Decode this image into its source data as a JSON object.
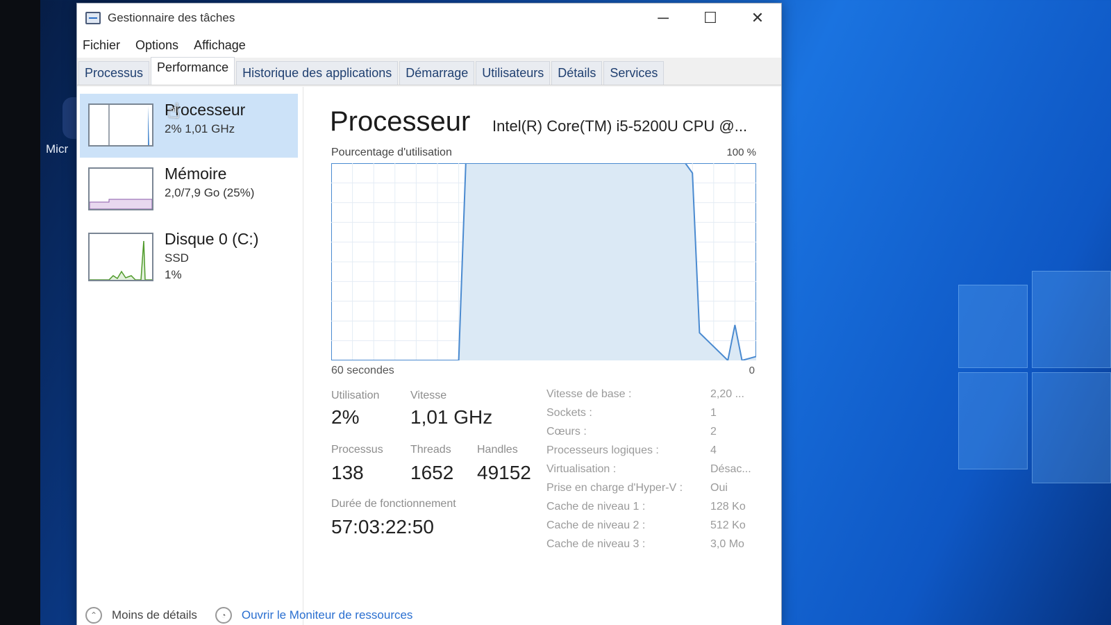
{
  "window": {
    "title": "Gestionnaire des tâches",
    "controls": {
      "minimize": "─",
      "maximize": "☐",
      "close": "✕"
    }
  },
  "menu": [
    "Fichier",
    "Options",
    "Affichage"
  ],
  "tabs": [
    "Processus",
    "Performance",
    "Historique des applications",
    "Démarrage",
    "Utilisateurs",
    "Détails",
    "Services"
  ],
  "active_tab": "Performance",
  "sidebar": {
    "items": [
      {
        "title": "Processeur",
        "sub1": "2% 1,01 GHz",
        "sub2": "",
        "selected": true
      },
      {
        "title": "Mémoire",
        "sub1": "2,0/7,9 Go (25%)",
        "sub2": ""
      },
      {
        "title": "Disque 0 (C:)",
        "sub1": "SSD",
        "sub2": "1%"
      }
    ]
  },
  "main": {
    "title": "Processeur",
    "cpu_name": "Intel(R) Core(TM) i5-5200U CPU @...",
    "chart_label": "Pourcentage d'utilisation",
    "chart_max": "100 %",
    "chart_foot_left": "60 secondes",
    "chart_foot_right": "0",
    "stats": {
      "utilisation_label": "Utilisation",
      "utilisation": "2%",
      "vitesse_label": "Vitesse",
      "vitesse": "1,01 GHz",
      "processus_label": "Processus",
      "processus": "138",
      "threads_label": "Threads",
      "threads": "1652",
      "handles_label": "Handles",
      "handles": "49152",
      "uptime_label": "Durée de fonctionnement",
      "uptime": "57:03:22:50"
    },
    "specs": [
      {
        "label": "Vitesse de base :",
        "value": "2,20 ..."
      },
      {
        "label": "Sockets :",
        "value": "1"
      },
      {
        "label": "Cœurs :",
        "value": "2"
      },
      {
        "label": "Processeurs logiques :",
        "value": "4"
      },
      {
        "label": "Virtualisation :",
        "value": "Désac..."
      },
      {
        "label": "Prise en charge d'Hyper-V :",
        "value": "Oui"
      },
      {
        "label": "Cache de niveau 1 :",
        "value": "128 Ko"
      },
      {
        "label": "Cache de niveau 2 :",
        "value": "512 Ko"
      },
      {
        "label": "Cache de niveau 3 :",
        "value": "3,0 Mo"
      }
    ]
  },
  "footer": {
    "less_details": "Moins de détails",
    "resource_monitor": "Ouvrir le Moniteur de ressources"
  },
  "desktop": {
    "icon_label": "Micr"
  },
  "colors": {
    "accent": "#2c6fc6",
    "selection": "#cce2f8",
    "chart_fill": "#dbe9f5",
    "chart_line": "#4a8ad0"
  },
  "chart_data": {
    "type": "area",
    "title": "",
    "xlabel": "60 secondes",
    "ylabel": "Pourcentage d'utilisation",
    "ylim": [
      0,
      100
    ],
    "xlim": [
      60,
      0
    ],
    "x": [
      60,
      42,
      41,
      38,
      10,
      9,
      8,
      4,
      3,
      2,
      1,
      0
    ],
    "values": [
      0,
      0,
      100,
      100,
      100,
      95,
      14,
      0,
      18,
      0,
      1,
      2
    ]
  }
}
